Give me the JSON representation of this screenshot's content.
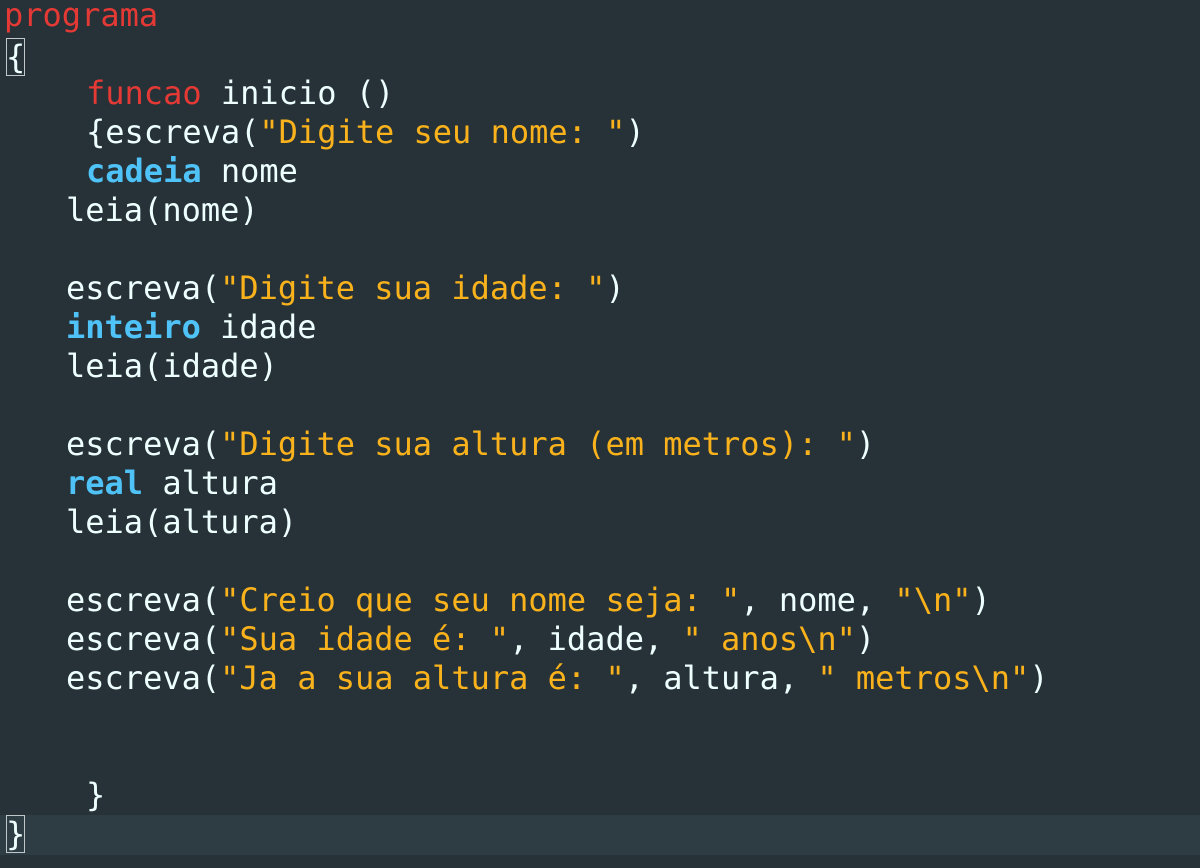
{
  "editor": {
    "colors": {
      "background": "#263238",
      "keyword_red": "#e53935",
      "keyword_type": "#4fc3f7",
      "string": "#f9b21c",
      "text": "#eeffff"
    },
    "lines": [
      {
        "tokens": [
          {
            "t": "programa",
            "c": "kw-red"
          }
        ]
      },
      {
        "tokens": [
          {
            "t": "{",
            "c": "plain",
            "hl": true
          }
        ]
      },
      {
        "tokens": [
          {
            "t": "funcao",
            "c": "kw-red"
          },
          {
            "t": " inicio ()",
            "c": "plain"
          }
        ]
      },
      {
        "tokens": [
          {
            "t": "{escreva(",
            "c": "plain"
          },
          {
            "t": "\"Digite seu nome: \"",
            "c": "str"
          },
          {
            "t": ")",
            "c": "plain"
          }
        ]
      },
      {
        "tokens": [
          {
            "t": "cadeia",
            "c": "kw-blue"
          },
          {
            "t": " nome",
            "c": "plain"
          }
        ]
      },
      {
        "tokens": [
          {
            "t": "leia(nome)",
            "c": "plain"
          }
        ]
      },
      {
        "tokens": [
          {
            "t": "escreva(",
            "c": "plain"
          },
          {
            "t": "\"Digite sua idade: \"",
            "c": "str"
          },
          {
            "t": ")",
            "c": "plain"
          }
        ]
      },
      {
        "tokens": [
          {
            "t": "inteiro",
            "c": "kw-blue"
          },
          {
            "t": " idade",
            "c": "plain"
          }
        ]
      },
      {
        "tokens": [
          {
            "t": "leia(idade)",
            "c": "plain"
          }
        ]
      },
      {
        "tokens": [
          {
            "t": "escreva(",
            "c": "plain"
          },
          {
            "t": "\"Digite sua altura (em metros): \"",
            "c": "str"
          },
          {
            "t": ")",
            "c": "plain"
          }
        ]
      },
      {
        "tokens": [
          {
            "t": "real",
            "c": "kw-blue"
          },
          {
            "t": " altura",
            "c": "plain"
          }
        ]
      },
      {
        "tokens": [
          {
            "t": "leia(altura)",
            "c": "plain"
          }
        ]
      },
      {
        "tokens": [
          {
            "t": "escreva(",
            "c": "plain"
          },
          {
            "t": "\"Creio que seu nome seja: \"",
            "c": "str"
          },
          {
            "t": ", nome, ",
            "c": "plain"
          },
          {
            "t": "\"\\n\"",
            "c": "str"
          },
          {
            "t": ")",
            "c": "plain"
          }
        ]
      },
      {
        "tokens": [
          {
            "t": "escreva(",
            "c": "plain"
          },
          {
            "t": "\"Sua idade é: \"",
            "c": "str"
          },
          {
            "t": ", idade, ",
            "c": "plain"
          },
          {
            "t": "\" anos\\n\"",
            "c": "str"
          },
          {
            "t": ")",
            "c": "plain"
          }
        ]
      },
      {
        "tokens": [
          {
            "t": "escreva(",
            "c": "plain"
          },
          {
            "t": "\"Ja a sua altura é: \"",
            "c": "str"
          },
          {
            "t": ", altura, ",
            "c": "plain"
          },
          {
            "t": "\" metros\\n\"",
            "c": "str"
          },
          {
            "t": ")",
            "c": "plain"
          }
        ]
      },
      {
        "tokens": [
          {
            "t": "}",
            "c": "plain"
          }
        ]
      },
      {
        "tokens": [
          {
            "t": "}",
            "c": "plain",
            "hl": true
          }
        ]
      }
    ]
  }
}
